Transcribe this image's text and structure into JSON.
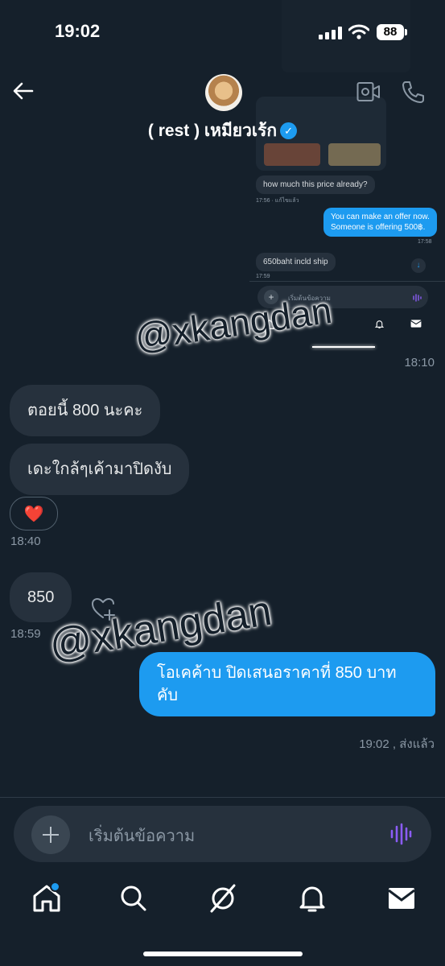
{
  "status_bar": {
    "time": "19:02",
    "battery": "88"
  },
  "header": {
    "title": "( rest ) เหมียวเร้ก",
    "verified_mark": "✓"
  },
  "embedded_screenshot": {
    "message_in_1": "how much this price already?",
    "timestamp_1": "17:56 · แก้ไขแล้ว",
    "message_out_1_line1": "You can make an offer now.",
    "message_out_1_line2": "Someone is offering 500฿.",
    "timestamp_2": "17:58",
    "message_in_2": "650baht incld ship",
    "timestamp_3": "17:59",
    "input_placeholder": "เริ่มต้นข้อความ"
  },
  "watermark": {
    "text_1": "@xkangdan",
    "text_2": "@xkangdan"
  },
  "messages": {
    "image_timestamp": "18:10",
    "in_1": "ตอยนี้ 800 นะคะ",
    "in_2": "เดะใกล้ๆเค้ามาปิดงับ",
    "reaction": "❤️",
    "group_1_timestamp": "18:40",
    "in_3": "850",
    "group_2_timestamp": "18:59",
    "out_1": "โอเคค้าบ ปิดเสนอราคาที่ 850 บาท คับ",
    "out_1_status": "19:02 , ส่งแล้ว"
  },
  "composer": {
    "placeholder": "เริ่มต้นข้อความ"
  },
  "colors": {
    "background": "#15202b",
    "bubble_in": "#26313d",
    "accent": "#1d9bf0",
    "voice": "#8b5cf6"
  },
  "icons": [
    "back-arrow-icon",
    "video-call-icon",
    "phone-icon",
    "plus-icon",
    "voice-icon",
    "home-icon",
    "search-icon",
    "grok-icon",
    "bell-icon",
    "mail-icon",
    "heart-plus-icon"
  ]
}
